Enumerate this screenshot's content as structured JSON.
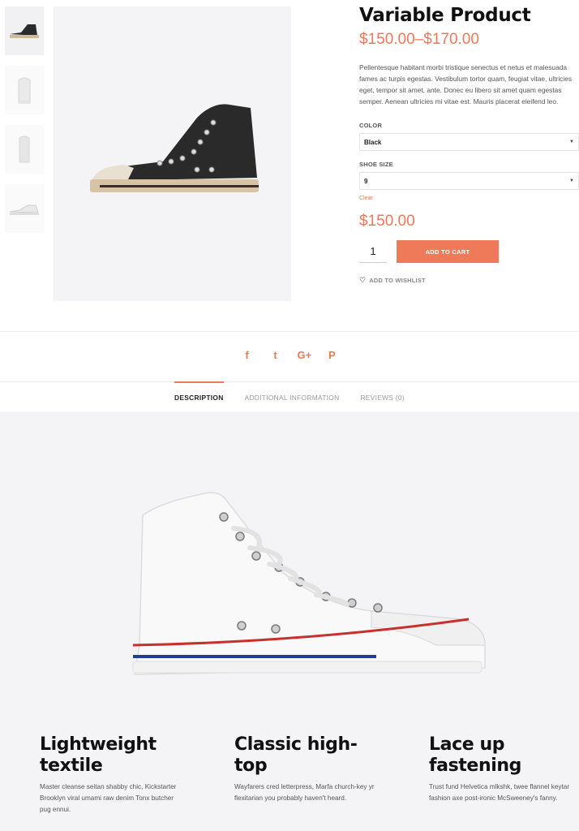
{
  "product": {
    "title": "Variable Product",
    "price_range": "$150.00–$170.00",
    "description": "Pellentesque habitant morbi tristique senectus et netus et malesuada fames ac turpis egestas. Vestibulum tortor quam, feugiat vitae, ultricies eget, tempor sit amet, ante. Donec eu libero sit amet quam egestas semper. Aenean ultricies mi vitae est. Mauris placerat eleifend leo.",
    "color_label": "COLOR",
    "color_value": "Black",
    "size_label": "SHOE SIZE",
    "size_value": "9",
    "clear_label": "Clear",
    "price": "$150.00",
    "quantity": "1",
    "add_to_cart": "ADD TO CART",
    "wishlist": "ADD TO WISHLIST"
  },
  "gallery": {
    "thumbnails": [
      "black-hightop",
      "white-hightop-front",
      "white-hightop-back",
      "white-lowtop"
    ]
  },
  "social": [
    "f",
    "t",
    "G+",
    "P"
  ],
  "tabs": [
    {
      "label": "DESCRIPTION",
      "active": true
    },
    {
      "label": "ADDITIONAL INFORMATION",
      "active": false
    },
    {
      "label": "REVIEWS (0)",
      "active": false
    }
  ],
  "features": [
    {
      "title": "Lightweight textile",
      "text": "Master cleanse seitan shabby chic, Kickstarter Brooklyn viral umami raw denim Tonx butcher pug ennui."
    },
    {
      "title": "Classic high-top",
      "text": "Wayfarers cred letterpress, Marfa church-key yr flexitarian you probably haven't heard."
    },
    {
      "title": "Lace up fastening",
      "text": "Trust fund Helvetica mlkshk, twee flannel keytar fashion axe post-ironic McSweeney's fanny."
    }
  ],
  "colors": {
    "accent": "#ea7a5a",
    "panel_bg": "#f4f4f6"
  }
}
